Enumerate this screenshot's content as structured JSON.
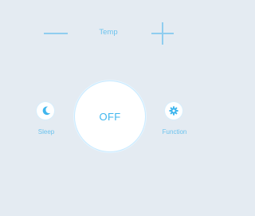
{
  "controls": {
    "temp_label": "Temp",
    "power_label": "OFF",
    "sleep_label": "Sleep",
    "function_label": "Function"
  },
  "icons": {
    "minus": "minus-icon",
    "plus": "plus-icon",
    "sleep": "moon-icon",
    "function": "gear-icon"
  },
  "colors": {
    "background": "#e4ebf2",
    "accent": "#3fb6ee",
    "accent_light": "#8fcdef",
    "button_bg": "#ffffff"
  }
}
